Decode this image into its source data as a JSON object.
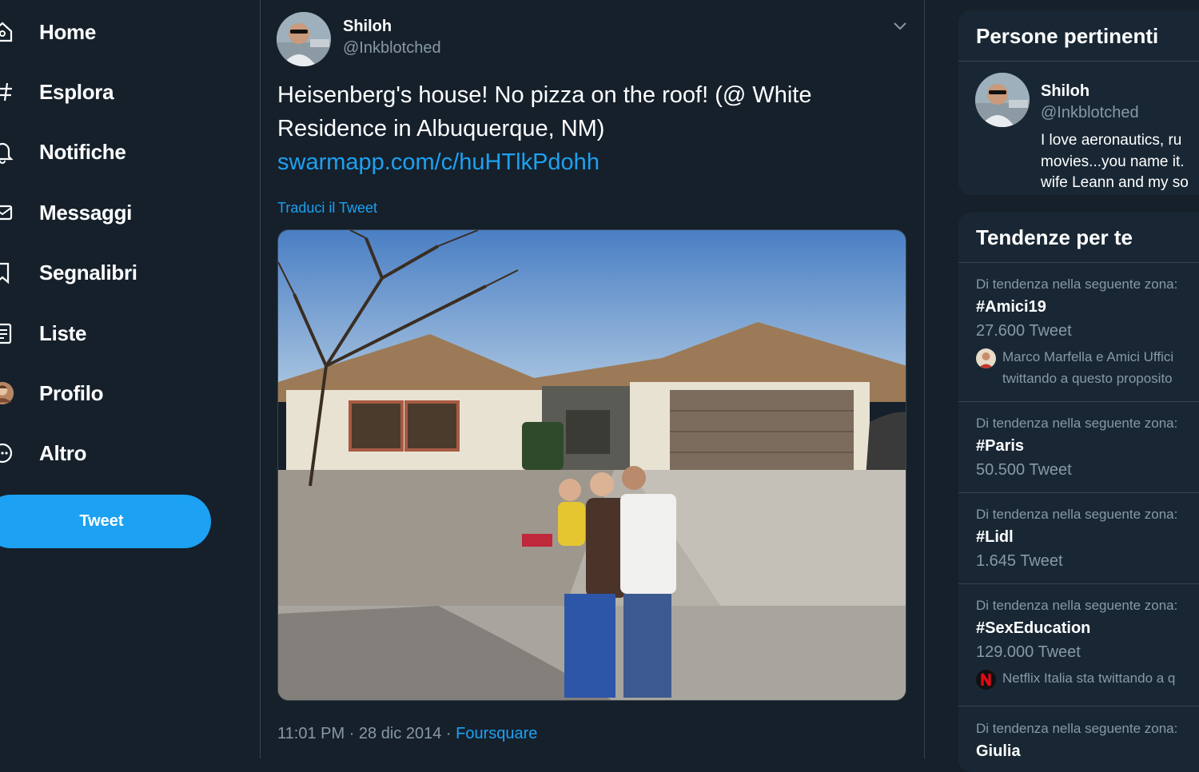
{
  "nav": {
    "items": [
      {
        "label": "Home",
        "icon": "home-icon"
      },
      {
        "label": "Esplora",
        "icon": "hashtag-icon"
      },
      {
        "label": "Notifiche",
        "icon": "bell-icon"
      },
      {
        "label": "Messaggi",
        "icon": "envelope-icon"
      },
      {
        "label": "Segnalibri",
        "icon": "bookmark-icon"
      },
      {
        "label": "Liste",
        "icon": "list-icon"
      },
      {
        "label": "Profilo",
        "icon": "avatar"
      },
      {
        "label": "Altro",
        "icon": "more-icon"
      }
    ],
    "tweet_button": "Tweet"
  },
  "tweet": {
    "author_name": "Shiloh",
    "author_handle": "@Inkblotched",
    "text": "Heisenberg's house!  No pizza on the roof! (@ White Residence in Albuquerque, NM)",
    "link": "swarmapp.com/c/huHTlkPdohh",
    "translate": "Traduci il Tweet",
    "time": "11:01 PM",
    "date": "28 dic 2014",
    "source": "Foursquare",
    "separator": "·"
  },
  "relevant_people": {
    "title": "Persone pertinenti",
    "name": "Shiloh",
    "handle": "@Inkblotched",
    "bio_lines": [
      "I love aeronautics, ru",
      "movies...you name it.",
      "wife Leann and my so"
    ]
  },
  "trends": {
    "title": "Tendenze per te",
    "items": [
      {
        "context": "Di tendenza nella seguente zona:",
        "tag": "#Amici19",
        "count": "27.600 Tweet",
        "extra_1": "Marco Marfella e Amici Uffici",
        "extra_2": "twittando a questo proposito"
      },
      {
        "context": "Di tendenza nella seguente zona:",
        "tag": "#Paris",
        "count": "50.500 Tweet"
      },
      {
        "context": "Di tendenza nella seguente zona:",
        "tag": "#Lidl",
        "count": "1.645 Tweet"
      },
      {
        "context": "Di tendenza nella seguente zona:",
        "tag": "#SexEducation",
        "count": "129.000 Tweet",
        "extra_1": "Netflix Italia sta twittando a q"
      },
      {
        "context": "Di tendenza nella seguente zona:",
        "tag": "Giulia"
      }
    ]
  },
  "colors": {
    "background": "#15202b",
    "panel": "#192734",
    "accent": "#1da1f2",
    "muted": "#8899a6",
    "border": "#38444d"
  }
}
